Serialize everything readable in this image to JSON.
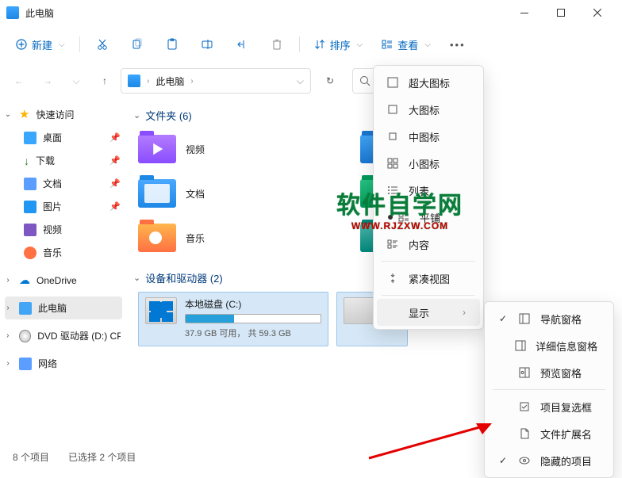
{
  "window": {
    "title": "此电脑"
  },
  "toolbar": {
    "new": "新建",
    "sort": "排序",
    "view": "查看"
  },
  "address": {
    "root": "此电脑"
  },
  "sidebar": {
    "quick": "快速访问",
    "desktop": "桌面",
    "downloads": "下载",
    "documents": "文档",
    "pictures": "图片",
    "videos": "视频",
    "music": "音乐",
    "onedrive": "OneDrive",
    "thispc": "此电脑",
    "dvd": "DVD 驱动器 (D:) CP",
    "network": "网络"
  },
  "groups": {
    "folders": "文件夹 (6)",
    "drives": "设备和驱动器 (2)"
  },
  "folders": {
    "videos": "视频",
    "documents": "文档",
    "music": "音乐"
  },
  "drives": {
    "c_name": "本地磁盘 (C:)",
    "c_free": "37.9 GB 可用， 共 59.3 GB",
    "c_used_pct": 36
  },
  "status": {
    "items": "8 个项目",
    "selected": "已选择 2 个项目"
  },
  "menu_view": {
    "xl": "超大图标",
    "lg": "大图标",
    "md": "中图标",
    "sm": "小图标",
    "list": "列表",
    "tiles": "平铺",
    "content": "内容",
    "compact": "紧凑视图",
    "show": "显示"
  },
  "menu_show": {
    "nav": "导航窗格",
    "details": "详细信息窗格",
    "preview": "预览窗格",
    "checkboxes": "项目复选框",
    "ext": "文件扩展名",
    "hidden": "隐藏的项目"
  },
  "watermark": {
    "main": "软件自学网",
    "sub": "WWW.RJZXW.COM"
  }
}
